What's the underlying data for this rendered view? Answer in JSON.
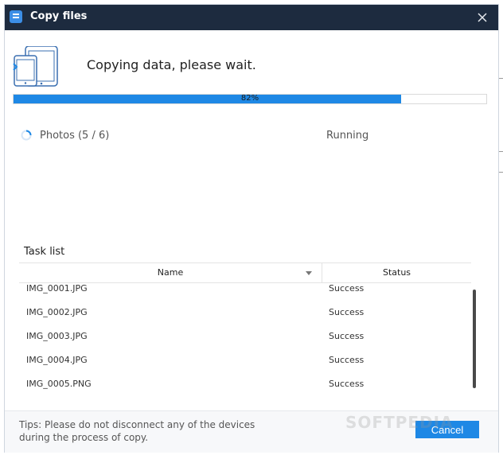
{
  "window": {
    "title": "Copy files"
  },
  "header": {
    "message": "Copying data, please wait."
  },
  "progress": {
    "percent": 82,
    "label": "82%"
  },
  "current_job": {
    "label": "Photos (5 / 6)",
    "status": "Running"
  },
  "task_list": {
    "label": "Task list",
    "columns": {
      "name": "Name",
      "status": "Status"
    },
    "rows": [
      {
        "name": "IMG_0001.JPG",
        "status": "Success"
      },
      {
        "name": "IMG_0002.JPG",
        "status": "Success"
      },
      {
        "name": "IMG_0003.JPG",
        "status": "Success"
      },
      {
        "name": "IMG_0004.JPG",
        "status": "Success"
      },
      {
        "name": "IMG_0005.PNG",
        "status": "Success"
      }
    ]
  },
  "footer": {
    "tips_line1": "Tips: Please do not disconnect any of the devices",
    "tips_line2": "during the process of copy.",
    "cancel_label": "Cancel"
  },
  "watermark": "SOFTPEDIA",
  "colors": {
    "titlebar": "#1d2b3f",
    "accent": "#1e88e5"
  },
  "icons": {
    "app": "app-logo-icon",
    "devices": "tablet-phone-icon",
    "close": "close-icon",
    "spinner": "loading-spinner-icon",
    "sort": "sort-down-icon"
  }
}
